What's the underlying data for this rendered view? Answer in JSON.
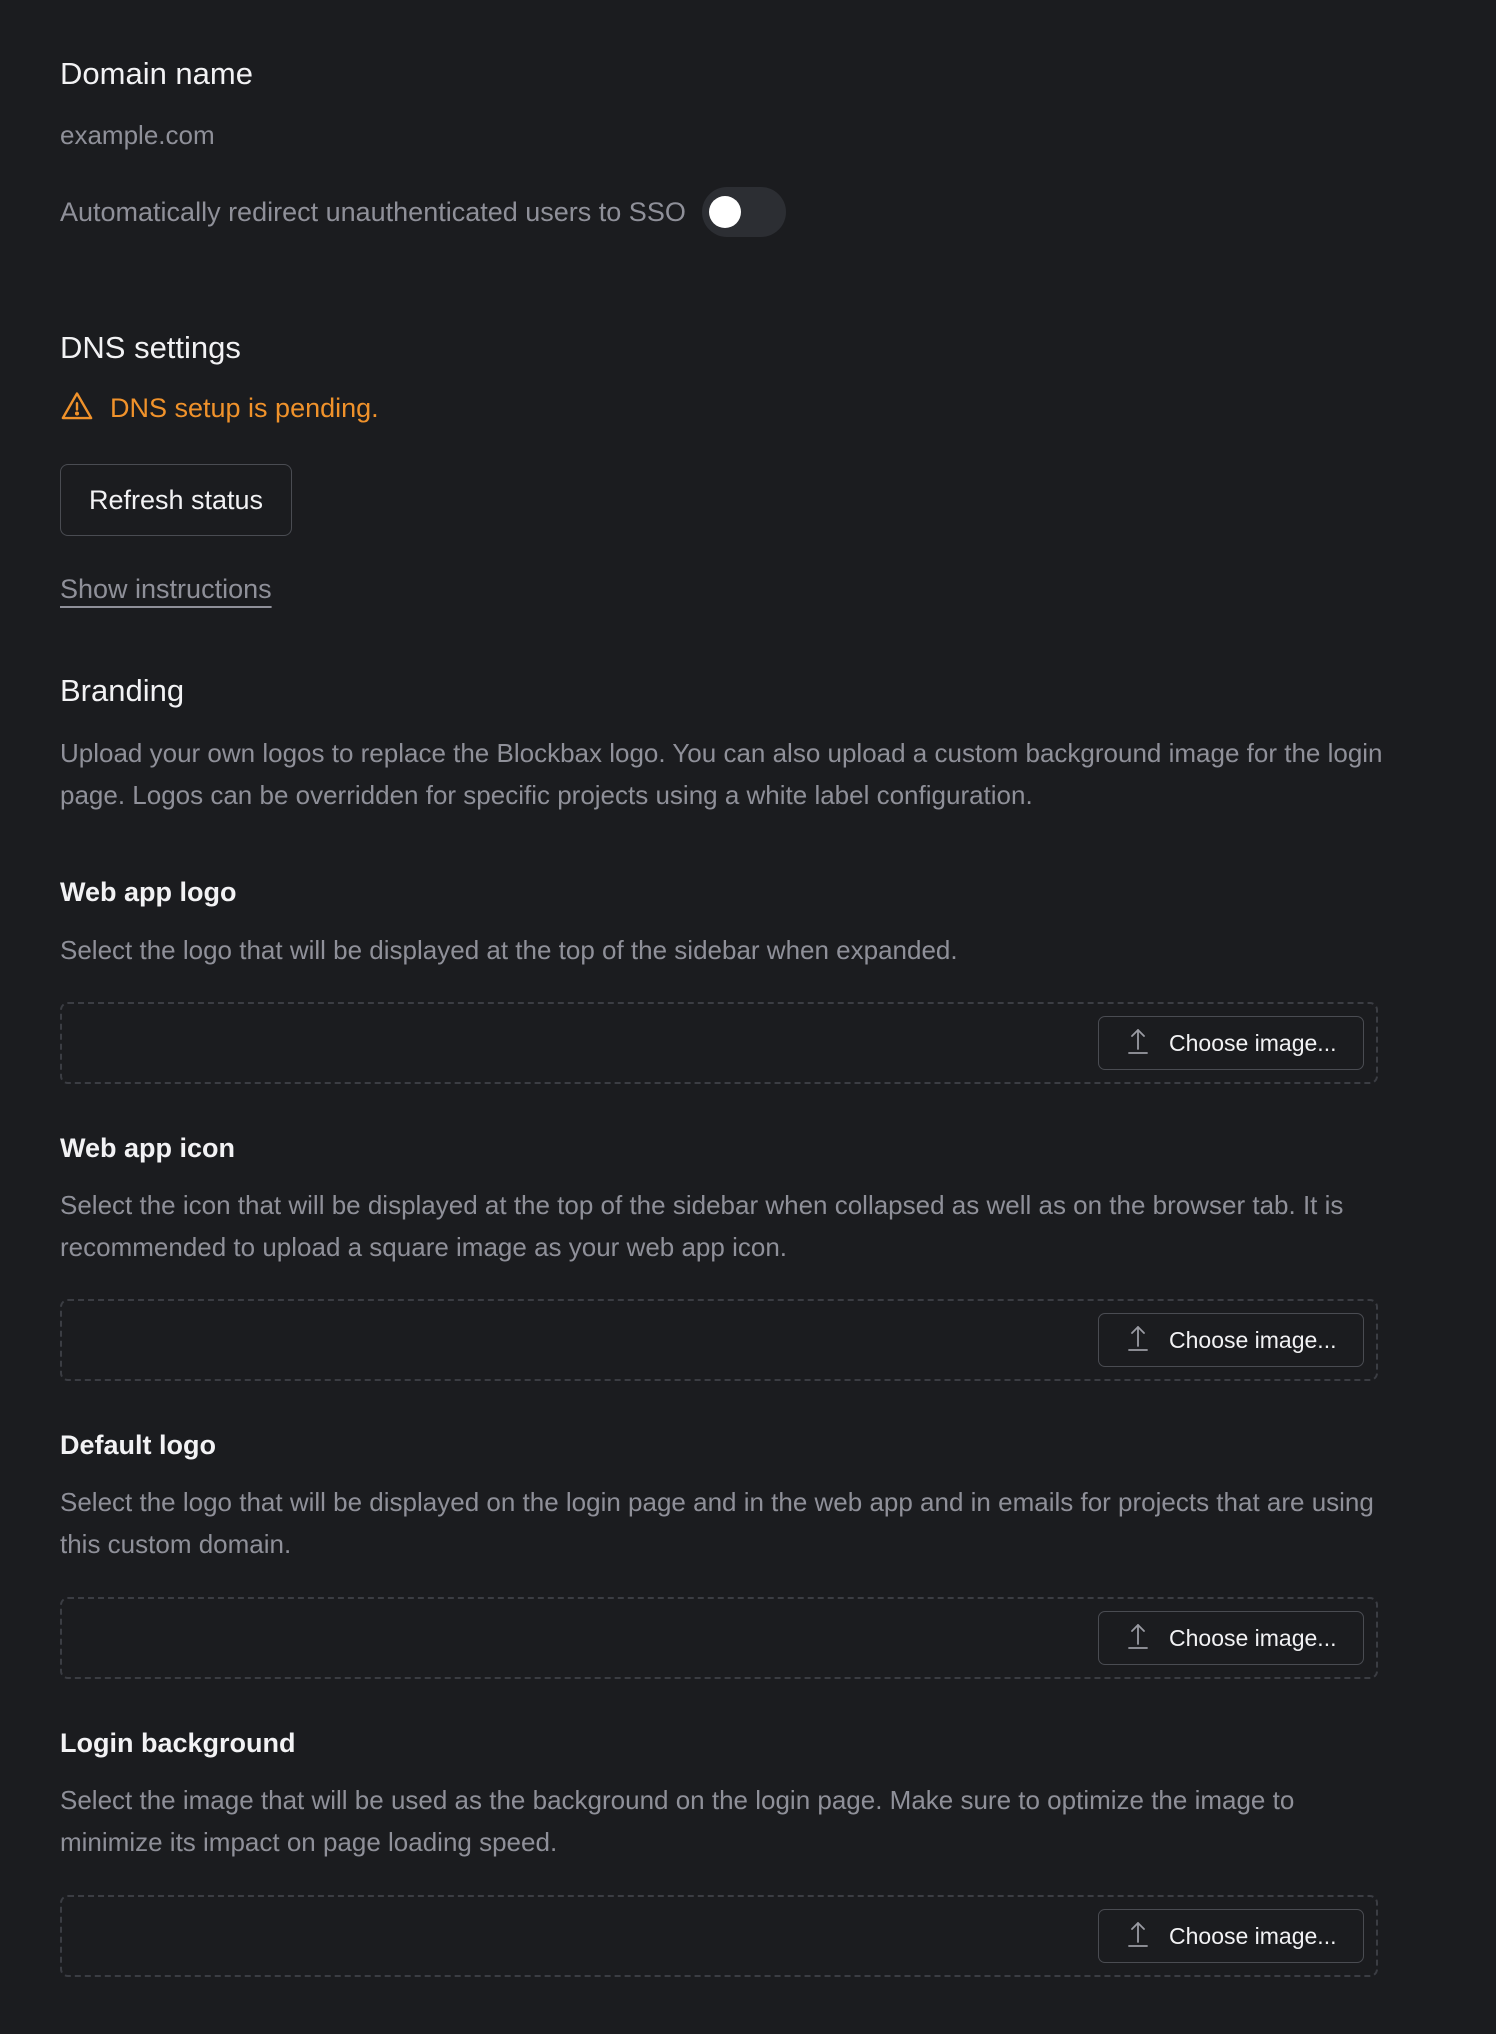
{
  "domain": {
    "heading": "Domain name",
    "value": "example.com",
    "sso_label": "Automatically redirect unauthenticated users to SSO",
    "sso_enabled": false
  },
  "dns": {
    "heading": "DNS settings",
    "status_text": "DNS setup is pending.",
    "status_color": "#f0922b",
    "refresh_label": "Refresh status",
    "instructions_link": "Show instructions"
  },
  "branding": {
    "heading": "Branding",
    "description": "Upload your own logos to replace the Blockbax logo. You can also upload a custom background image for the login page. Logos can be overridden for specific projects using a white label configuration.",
    "items": [
      {
        "title": "Web app logo",
        "description": "Select the logo that will be displayed at the top of the sidebar when expanded.",
        "button_label": "Choose image..."
      },
      {
        "title": "Web app icon",
        "description": "Select the icon that will be displayed at the top of the sidebar when collapsed as well as on the browser tab. It is recommended to upload a square image as your web app icon.",
        "button_label": "Choose image..."
      },
      {
        "title": "Default logo",
        "description": "Select the logo that will be displayed on the login page and in the web app and in emails for projects that are using this custom domain.",
        "button_label": "Choose image..."
      },
      {
        "title": "Login background",
        "description": "Select the image that will be used as the background on the login page. Make sure to optimize the image to minimize its impact on page loading speed.",
        "button_label": "Choose image..."
      }
    ]
  }
}
